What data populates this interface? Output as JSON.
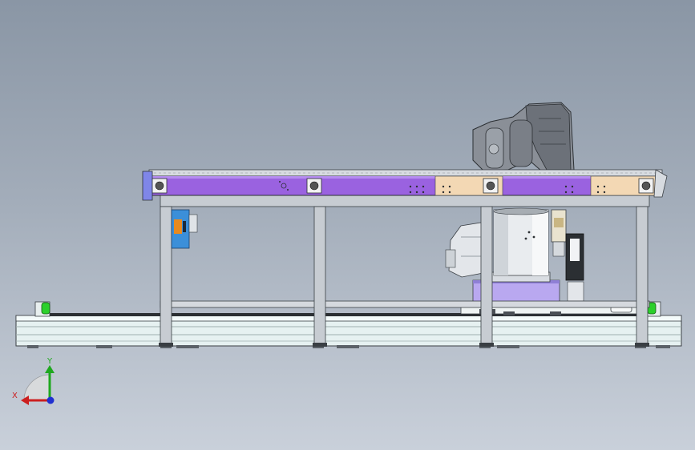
{
  "viewport": {
    "background_top": "#8a96a5",
    "background_bottom": "#c9d0da"
  },
  "model": {
    "conveyor_color": "#9a62e0",
    "guard_plate_color": "#f3d8b4",
    "frame_color": "#c7ccd2",
    "base_color": "#e6f1f1",
    "robot_color": "#8a8f97",
    "bumper_color": "#2bd02b"
  },
  "triad": {
    "x_label": "X",
    "y_label": "Y",
    "x_color": "#cc1f1f",
    "y_color": "#1fa81f",
    "z_color": "#2030d0"
  }
}
